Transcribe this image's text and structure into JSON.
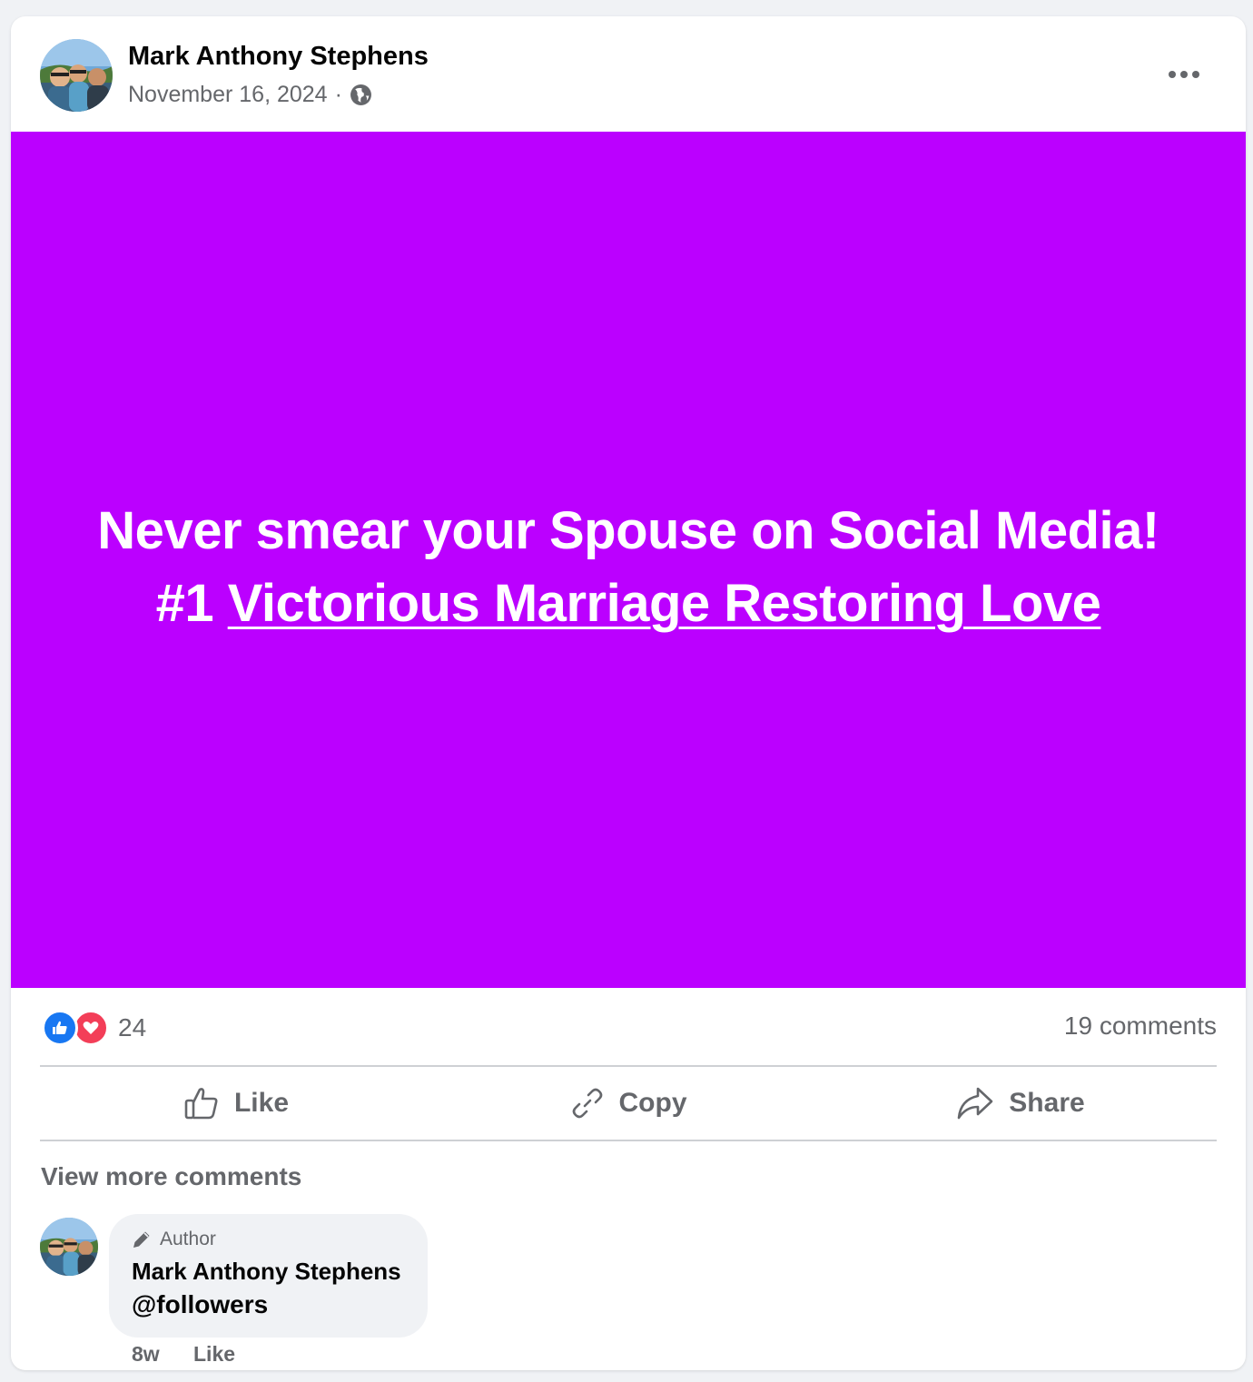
{
  "post": {
    "author": "Mark Anthony Stephens",
    "date": "November 16, 2024",
    "separator": "·",
    "privacy_icon": "globe-icon",
    "more_icon": "more-options-icon",
    "background_color": "#bb00ff",
    "text_line1": "Never smear your Spouse on Social Media!",
    "text_prefix": "#1 ",
    "text_link": "Victorious Marriage Restoring Love"
  },
  "engagement": {
    "reaction_icons": [
      "like-reaction-icon",
      "love-reaction-icon"
    ],
    "reaction_count": "24",
    "comment_count": "19 comments"
  },
  "actions": {
    "like": "Like",
    "copy": "Copy",
    "share": "Share"
  },
  "comments": {
    "view_more": "View more comments",
    "items": [
      {
        "badge": "Author",
        "name": "Mark Anthony Stephens",
        "text": "@followers",
        "time": "8w",
        "like": "Like"
      }
    ]
  },
  "colors": {
    "accent_blue": "#1877f2",
    "love_red": "#f33e58",
    "secondary_text": "#65676b"
  }
}
